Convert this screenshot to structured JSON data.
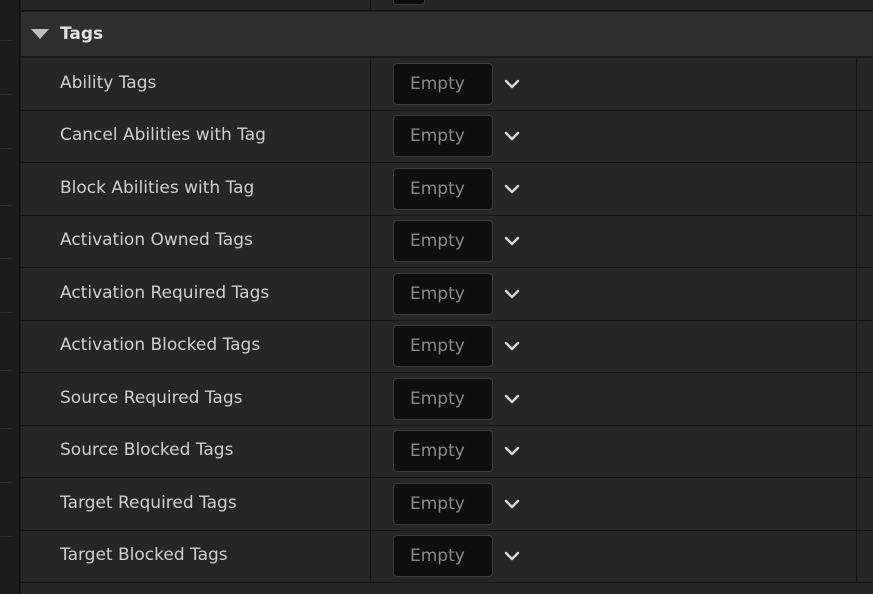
{
  "section": {
    "title": "Tags",
    "caret_icon": "caret-down-icon"
  },
  "rows": [
    {
      "label": "Ability Tags",
      "value": "Empty"
    },
    {
      "label": "Cancel Abilities with Tag",
      "value": "Empty"
    },
    {
      "label": "Block Abilities with Tag",
      "value": "Empty"
    },
    {
      "label": "Activation Owned Tags",
      "value": "Empty"
    },
    {
      "label": "Activation Required Tags",
      "value": "Empty"
    },
    {
      "label": "Activation Blocked Tags",
      "value": "Empty"
    },
    {
      "label": "Source Required Tags",
      "value": "Empty"
    },
    {
      "label": "Source Blocked Tags",
      "value": "Empty"
    },
    {
      "label": "Target Required Tags",
      "value": "Empty"
    },
    {
      "label": "Target Blocked Tags",
      "value": "Empty"
    }
  ],
  "colors": {
    "panel_bg": "#262626",
    "header_bg": "#2f2f2f",
    "value_box_bg": "#0f0f0f",
    "label_text": "#cfcfcf",
    "placeholder_text": "#8a8a8a"
  },
  "icons": {
    "dropdown": "chevron-down-icon"
  }
}
